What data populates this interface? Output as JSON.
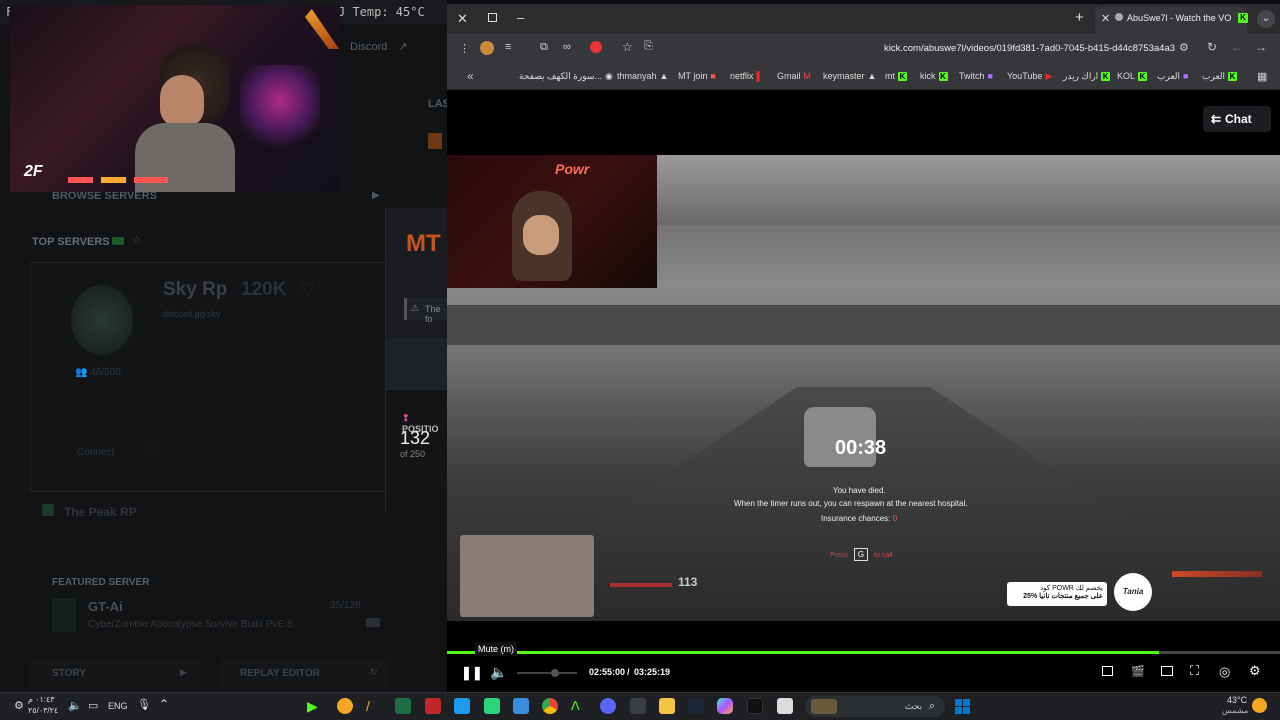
{
  "terminal": {
    "left_label": "F",
    "temp_text": "J Temp: 45°C"
  },
  "bg_app": {
    "discord_label": "Discord",
    "last_label": "LAS",
    "browse_servers": "BROWSE SERVERS",
    "top_servers": "TOP SERVERS",
    "server_name": "Sky Rp",
    "server_count": "120K",
    "server_sub": "discord.gg/sky",
    "server_players": "48/500",
    "connect": "Connect",
    "peak_rp": "The Peak RP",
    "featured": "FEATURED SERVER",
    "featured_name": "GT-Ai",
    "featured_desc": "CyberZombie Apocalypse Survive Build PvE 8",
    "featured_count": "35/128",
    "story": "STORY",
    "replay_editor": "REPLAY EDITOR",
    "mt_logo": "MT",
    "the_fo": "The fo",
    "position_label": "POSITIO",
    "position_value": "132",
    "position_of": "of 250"
  },
  "cam_logo": "2F",
  "browser": {
    "tab_title": "AbuSwe7l - Watch the VOD",
    "url": "kick.com/abuswe7l/videos/019fd381-7ad0-7045-b415-d44c8753a4a3",
    "bookmarks": [
      {
        "label": "سورة الكهف بصفحة..."
      },
      {
        "label": "thmanyah"
      },
      {
        "label": "MT join"
      },
      {
        "label": "netflix"
      },
      {
        "label": "Gmail"
      },
      {
        "label": "keymaster"
      },
      {
        "label": "mt"
      },
      {
        "label": "kick"
      },
      {
        "label": "Twitch"
      },
      {
        "label": "YouTube"
      },
      {
        "label": "اراك ريدر"
      },
      {
        "label": "KOL"
      },
      {
        "label": "العرب"
      },
      {
        "label": "العرب"
      }
    ]
  },
  "player": {
    "chat_button": "Chat",
    "timer": "00:38",
    "died_line1": "You have died.",
    "died_line2": "When the timer runs out, you can respawn at the nearest hospital.",
    "insurance": "Insurance chances:",
    "insurance_val": "0",
    "press": "Press",
    "key": "G",
    "to_call": "to call",
    "speed": "113",
    "ad_line1": "كود POWR يخصم لك",
    "ad_line2": "25% على جميع منتجات تانيا",
    "ad_brand": "Tania",
    "cam_sign": "Powr",
    "tooltip": "Mute (m)",
    "current_time": "02:55:00",
    "separator": "/",
    "total_time": "03:25:19",
    "progress": 0.855
  },
  "taskbar": {
    "lang": "ENG",
    "date_time": "٠١:٤٣ م",
    "date": "٢٥/٠٣/٢٤",
    "search_placeholder": "بحث",
    "weather_temp": "43°C",
    "weather_desc": "مشمس"
  }
}
